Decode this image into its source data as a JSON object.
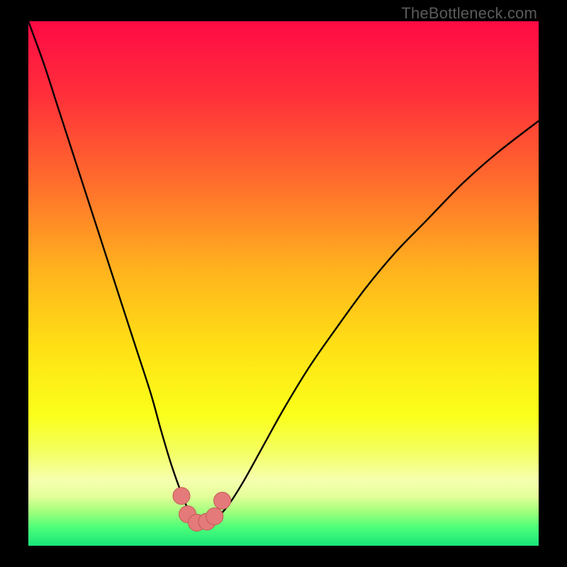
{
  "attribution": "TheBottleneck.com",
  "colors": {
    "frame": "#000000",
    "attribution_text": "#5b5b5b",
    "curve_stroke": "#000000",
    "marker_fill": "#e47a79",
    "marker_stroke": "#c25a57",
    "gradient_stops": [
      {
        "offset": 0.0,
        "color": "#ff0a45"
      },
      {
        "offset": 0.14,
        "color": "#ff2f3a"
      },
      {
        "offset": 0.3,
        "color": "#ff6a2d"
      },
      {
        "offset": 0.47,
        "color": "#ffb11e"
      },
      {
        "offset": 0.62,
        "color": "#ffe015"
      },
      {
        "offset": 0.75,
        "color": "#fbff1a"
      },
      {
        "offset": 0.82,
        "color": "#f4ff60"
      },
      {
        "offset": 0.875,
        "color": "#f6ffb0"
      },
      {
        "offset": 0.905,
        "color": "#e4ff9a"
      },
      {
        "offset": 0.935,
        "color": "#a1ff7d"
      },
      {
        "offset": 0.965,
        "color": "#4dff79"
      },
      {
        "offset": 1.0,
        "color": "#18e57a"
      }
    ]
  },
  "chart_data": {
    "type": "line",
    "title": "",
    "xlabel": "",
    "ylabel": "",
    "ylim": [
      0,
      100
    ],
    "legend": false,
    "grid": false,
    "series": [
      {
        "name": "bottleneck-curve",
        "x": [
          0.0,
          3,
          6,
          9,
          12,
          15,
          18,
          21,
          24,
          26,
          28,
          30,
          31.5,
          33,
          34.5,
          36.5,
          39,
          42,
          46,
          50,
          55,
          60,
          66,
          72,
          78,
          85,
          92,
          100
        ],
        "y": [
          100,
          92,
          83,
          74,
          65,
          56,
          47,
          38,
          29,
          22,
          15.5,
          10,
          6.5,
          4.5,
          4.2,
          5,
          7.5,
          12,
          19,
          26,
          34,
          41,
          49,
          56,
          62,
          69,
          75,
          81
        ]
      }
    ],
    "markers": [
      {
        "x": 30.0,
        "y": 9.5
      },
      {
        "x": 31.2,
        "y": 6.0
      },
      {
        "x": 33.0,
        "y": 4.4
      },
      {
        "x": 35.0,
        "y": 4.6
      },
      {
        "x": 36.5,
        "y": 5.6
      },
      {
        "x": 38.0,
        "y": 8.6
      }
    ]
  }
}
